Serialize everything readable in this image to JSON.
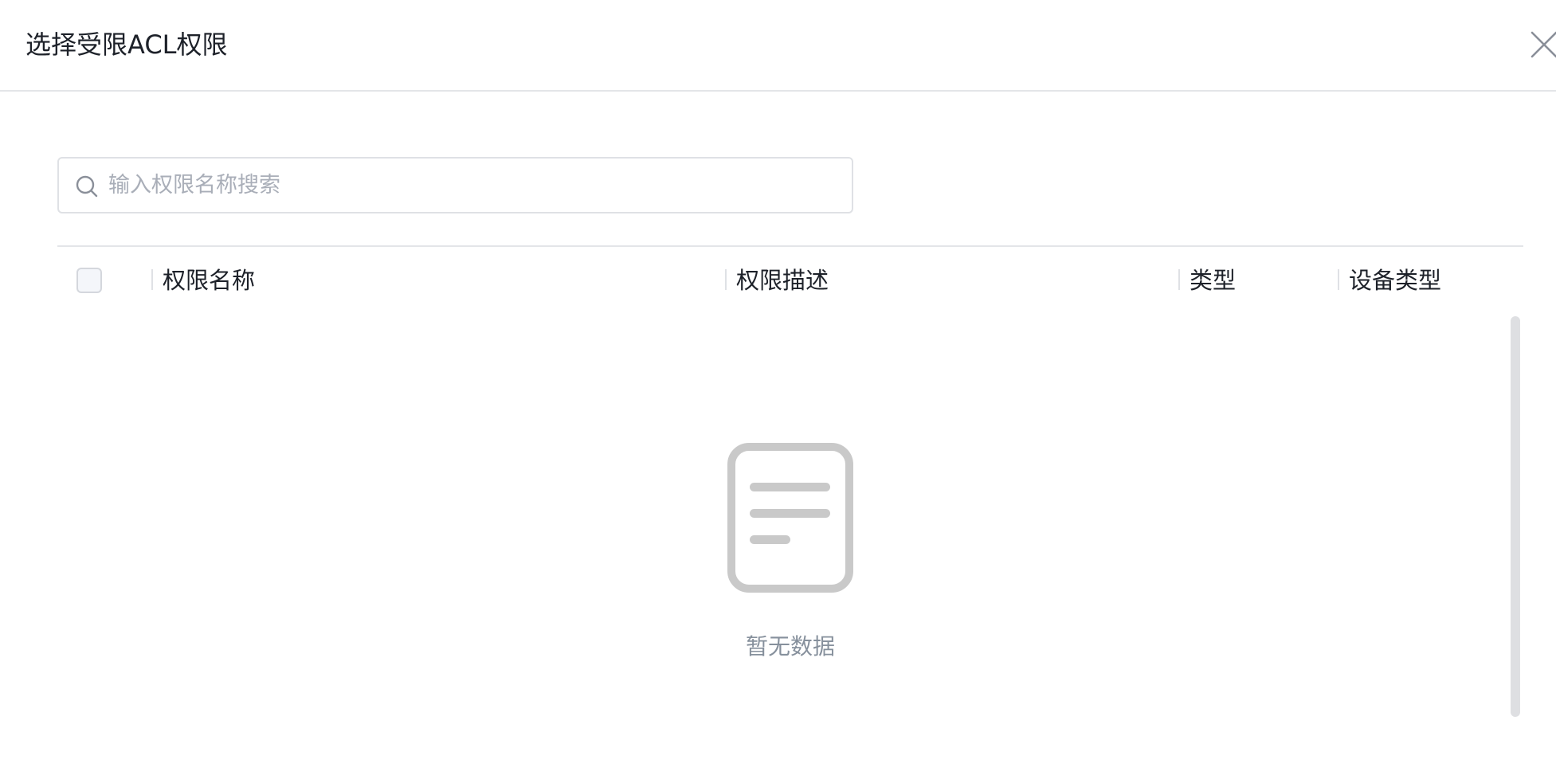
{
  "dialog": {
    "title": "选择受限ACL权限",
    "close_icon": "close-icon"
  },
  "search": {
    "icon": "search-icon",
    "placeholder": "输入权限名称搜索",
    "value": ""
  },
  "table": {
    "select_all_checked": false,
    "columns": [
      {
        "label": "权限名称"
      },
      {
        "label": "权限描述"
      },
      {
        "label": "类型"
      },
      {
        "label": "设备类型"
      }
    ],
    "rows": []
  },
  "empty_state": {
    "icon": "empty-document-icon",
    "text": "暂无数据"
  },
  "colors": {
    "text_primary": "#1d2129",
    "text_secondary": "#86909c",
    "placeholder": "#a9aeb8",
    "border": "#dfe1e5",
    "empty_icon": "#c9c9c9"
  }
}
